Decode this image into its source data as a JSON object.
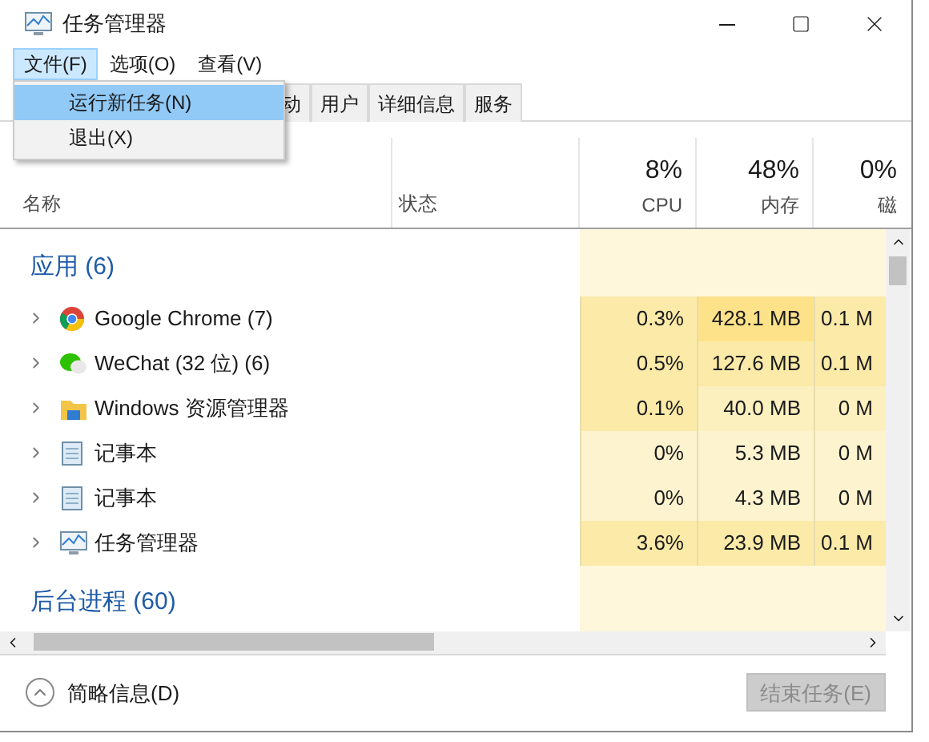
{
  "window": {
    "title": "任务管理器"
  },
  "menu": [
    {
      "label": "文件(F)",
      "selected": true
    },
    {
      "label": "选项(O)",
      "selected": false
    },
    {
      "label": "查看(V)",
      "selected": false
    }
  ],
  "dropdown": [
    {
      "label": "运行新任务(N)",
      "selected": true
    },
    {
      "label": "退出(X)",
      "selected": false
    }
  ],
  "tabs": [
    {
      "label": "动",
      "selected": false
    },
    {
      "label": "用户",
      "selected": false
    },
    {
      "label": "详细信息",
      "selected": false
    },
    {
      "label": "服务",
      "selected": false
    }
  ],
  "columns": [
    {
      "label": "名称"
    },
    {
      "label": "状态"
    },
    {
      "usage": "8%",
      "label": "CPU"
    },
    {
      "usage": "48%",
      "label": "内存"
    },
    {
      "usage": "0%",
      "label": "磁"
    }
  ],
  "groups": [
    {
      "title": "应用 (6)",
      "color": "#fff7dc",
      "rows": [
        {
          "name": "Google Chrome (7)",
          "kind": "chrome",
          "expanded": false,
          "cells": [
            {
              "text": "0.3%",
              "color": "#fbeaa8"
            },
            {
              "text": "428.1 MB",
              "color": "#fde28a"
            },
            {
              "text": "0.1 M",
              "color": "#fbeaa8"
            }
          ]
        },
        {
          "name": "WeChat (32 位) (6)",
          "kind": "wechat",
          "expanded": false,
          "cells": [
            {
              "text": "0.5%",
              "color": "#fbeaa8"
            },
            {
              "text": "127.6 MB",
              "color": "#fbeaa8"
            },
            {
              "text": "0.1 M",
              "color": "#fbeaa8"
            }
          ]
        },
        {
          "name": "Windows 资源管理器",
          "kind": "folder",
          "expanded": false,
          "cells": [
            {
              "text": "0.1%",
              "color": "#fbeaa8"
            },
            {
              "text": "40.0 MB",
              "color": "#fcf0bf"
            },
            {
              "text": "0 M",
              "color": "#fcf0bf"
            }
          ]
        },
        {
          "name": "记事本",
          "kind": "notepad",
          "expanded": false,
          "cells": [
            {
              "text": "0%",
              "color": "#fdf4cf"
            },
            {
              "text": "5.3 MB",
              "color": "#fdf4cf"
            },
            {
              "text": "0 M",
              "color": "#fdf4cf"
            }
          ]
        },
        {
          "name": "记事本",
          "kind": "notepad",
          "expanded": false,
          "cells": [
            {
              "text": "0%",
              "color": "#fdf4cf"
            },
            {
              "text": "4.3 MB",
              "color": "#fdf4cf"
            },
            {
              "text": "0 M",
              "color": "#fdf4cf"
            }
          ]
        },
        {
          "name": "任务管理器",
          "kind": "taskmgr",
          "expanded": false,
          "cells": [
            {
              "text": "3.6%",
              "color": "#fbeaa8"
            },
            {
              "text": "23.9 MB",
              "color": "#fbeaa8"
            },
            {
              "text": "0.1 M",
              "color": "#fbeaa8"
            }
          ]
        }
      ]
    },
    {
      "title": "后台进程 (60)",
      "color": "#fff7dc"
    }
  ],
  "footer": {
    "details": "简略信息(D)",
    "end_task": {
      "label": "结束任务(E)",
      "disabled": true
    }
  }
}
